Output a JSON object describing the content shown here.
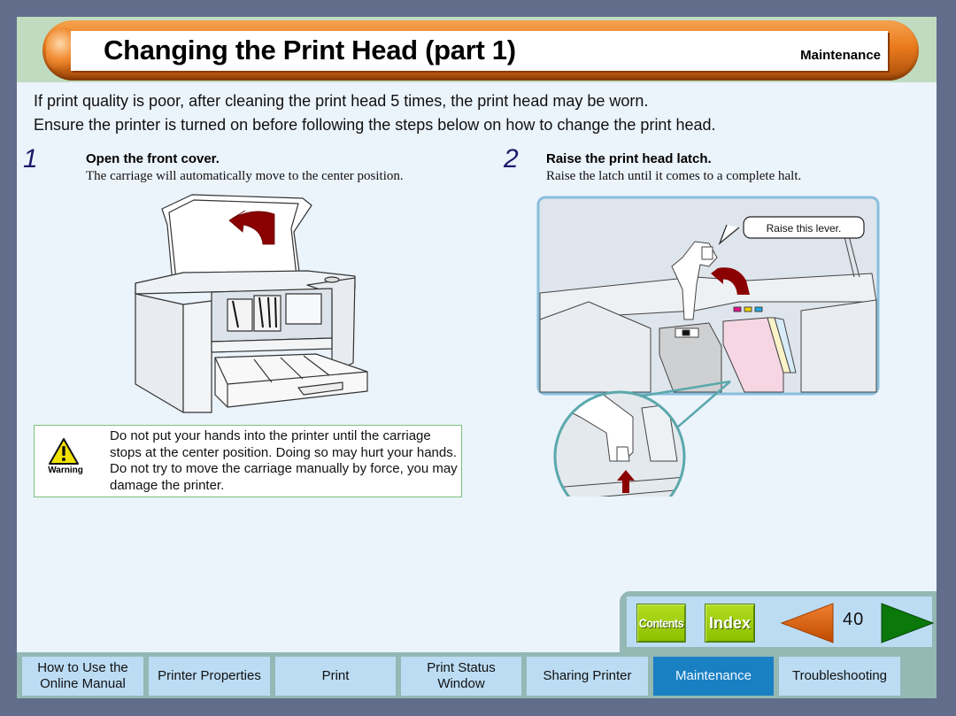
{
  "header": {
    "title": "Changing the Print Head (part 1)",
    "section": "Maintenance"
  },
  "intro": {
    "line1": "If print quality is poor, after cleaning the print head 5 times, the print head may be worn.",
    "line2": "Ensure the printer is turned on before following the steps below on how to change the print head."
  },
  "steps": [
    {
      "number": "1",
      "heading": "Open the front cover.",
      "description": "The carriage will automatically move to the center position.",
      "illustration": "printer-open-cover-illustration"
    },
    {
      "number": "2",
      "heading": "Raise the print head latch.",
      "description": "Raise the latch until it comes to a complete halt.",
      "illustration": "print-head-latch-illustration",
      "callout": "Raise this lever."
    }
  ],
  "warning": {
    "label": "Warning",
    "text": "Do not put your hands into the printer until the carriage stops at the center position. Doing so may hurt your hands. Do not try to move the carriage manually by force, you may damage the printer."
  },
  "nav": {
    "contents_label": "Contents",
    "index_label": "Index",
    "page_number": "40",
    "prev_icon": "prev-page-arrow-icon",
    "next_icon": "next-page-arrow-icon"
  },
  "tabs": [
    {
      "label": "How to Use the Online Manual",
      "active": false
    },
    {
      "label": "Printer Properties",
      "active": false
    },
    {
      "label": "Print",
      "active": false
    },
    {
      "label": "Print Status Window",
      "active": false
    },
    {
      "label": "Sharing Printer",
      "active": false
    },
    {
      "label": "Maintenance",
      "active": true
    },
    {
      "label": "Troubleshooting",
      "active": false
    }
  ],
  "colors": {
    "page_bg": "#616d8b",
    "content_bg": "#ebf3fb",
    "header_band": "#c0dcc0",
    "title_pill": "#e87a1c",
    "tab_bg": "#bcdcf4",
    "tab_active": "#1a80c4",
    "nav_button": "#8cc000",
    "prev_arrow": "#e06010",
    "next_arrow": "#0a780a",
    "instruction_arrow": "#8b0000"
  }
}
